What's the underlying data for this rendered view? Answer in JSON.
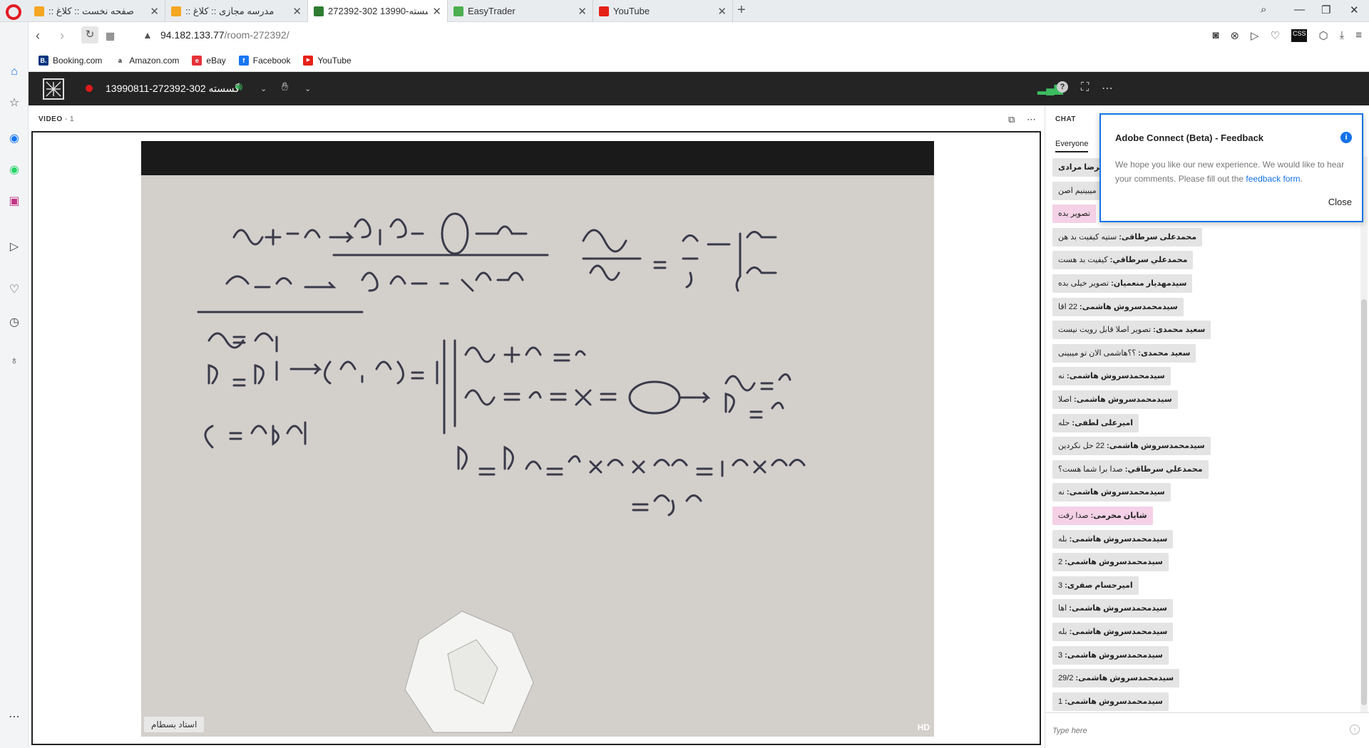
{
  "browser": {
    "tabs": [
      {
        "label": ":: صفحه نخست :: کلاغ",
        "fav_color": "#f5a623"
      },
      {
        "label": ":: مدرسه مجازی :: کلاغ",
        "fav_color": "#f5a623"
      },
      {
        "label": "272392-302 گسسته-13990",
        "fav_color": "#2e7d32"
      },
      {
        "label": "EasyTrader",
        "fav_color": "#4caf50"
      },
      {
        "label": "YouTube",
        "fav_color": "#e62117"
      }
    ],
    "new_tab": "+",
    "url_host": "94.182.133.77",
    "url_path": "/room-272392/",
    "bookmarks": [
      {
        "label": "Booking.com",
        "icon": "B.",
        "color": "#003580"
      },
      {
        "label": "Amazon.com",
        "icon": "a",
        "color": "#222222"
      },
      {
        "label": "eBay",
        "icon": "e",
        "color": "#e53238"
      },
      {
        "label": "Facebook",
        "icon": "f",
        "color": "#1877f2"
      },
      {
        "label": "YouTube",
        "icon": "▶",
        "color": "#e62117"
      }
    ]
  },
  "meeting": {
    "title": "13990811-272392-302 گسسته"
  },
  "video_pod": {
    "title": "VIDEO",
    "count": "- 1",
    "presenter": "استاد بسطام",
    "quality": "HD"
  },
  "chat_pod": {
    "title": "CHAT",
    "tab": "Everyone",
    "input_placeholder": "Type here",
    "messages": [
      {
        "name": "امیرضا مرادی",
        "text": "",
        "pink": false
      },
      {
        "name": "",
        "text": "میبینیم اصن",
        "pink": false
      },
      {
        "name": "",
        "text": "تصویر بده",
        "pink": true
      },
      {
        "name": "محمدعلی سرطاقی:",
        "text": "ستیه کیفیت بد هن",
        "pink": false
      },
      {
        "name": "محمدعلي سرطاقي:",
        "text": "کیفیت بد هست",
        "pink": false
      },
      {
        "name": "سیدمهدیار منعمیان:",
        "text": "تصویر خیلی بده",
        "pink": false
      },
      {
        "name": "سیدمحمدسروش هاشمی:",
        "text": "22 اقا",
        "pink": false
      },
      {
        "name": "سعید محمدی:",
        "text": "تصویر اصلا قابل رویت نیست",
        "pink": false
      },
      {
        "name": "سعید محمدی:",
        "text": "؟؟هاشمی الان تو میبینی",
        "pink": false
      },
      {
        "name": "سیدمحمدسروش هاشمی:",
        "text": "نه",
        "pink": false
      },
      {
        "name": "سیدمحمدسروش هاشمی:",
        "text": "اصلا",
        "pink": false
      },
      {
        "name": "امیرعلی لطفی:",
        "text": "حله",
        "pink": false
      },
      {
        "name": "سیدمحمدسروش هاشمی:",
        "text": "22 حل نکردین",
        "pink": false
      },
      {
        "name": "محمدعلي سرطاقي:",
        "text": "صدا برا شما هست؟",
        "pink": false
      },
      {
        "name": "سیدمحمدسروش هاشمی:",
        "text": "نه",
        "pink": false
      },
      {
        "name": "شایان محرمی:",
        "text": "صدا رفت",
        "pink": true
      },
      {
        "name": "سیدمحمدسروش هاشمی:",
        "text": "بله",
        "pink": false
      },
      {
        "name": "سیدمحمدسروش هاشمی:",
        "text": "2",
        "pink": false
      },
      {
        "name": "امیرحسام صفری:",
        "text": "3",
        "pink": false
      },
      {
        "name": "سیدمحمدسروش هاشمی:",
        "text": "اها",
        "pink": false
      },
      {
        "name": "سیدمحمدسروش هاشمی:",
        "text": "بله",
        "pink": false
      },
      {
        "name": "سیدمحمدسروش هاشمی:",
        "text": "3",
        "pink": false
      },
      {
        "name": "سیدمحمدسروش هاشمی:",
        "text": "29/2",
        "pink": false
      },
      {
        "name": "سیدمحمدسروش هاشمی:",
        "text": "1",
        "pink": false
      }
    ]
  },
  "feedback": {
    "title": "Adobe Connect (Beta) - Feedback",
    "body": "We hope you like our new experience. We would like to hear your comments. Please fill out the ",
    "link": "feedback form",
    "period": ".",
    "close": "Close",
    "info": "i"
  },
  "colors": {
    "accent_blue": "#1473e6",
    "record_red": "#e0191b",
    "header_dark": "#242424",
    "signal_green": "#3dbb61"
  }
}
